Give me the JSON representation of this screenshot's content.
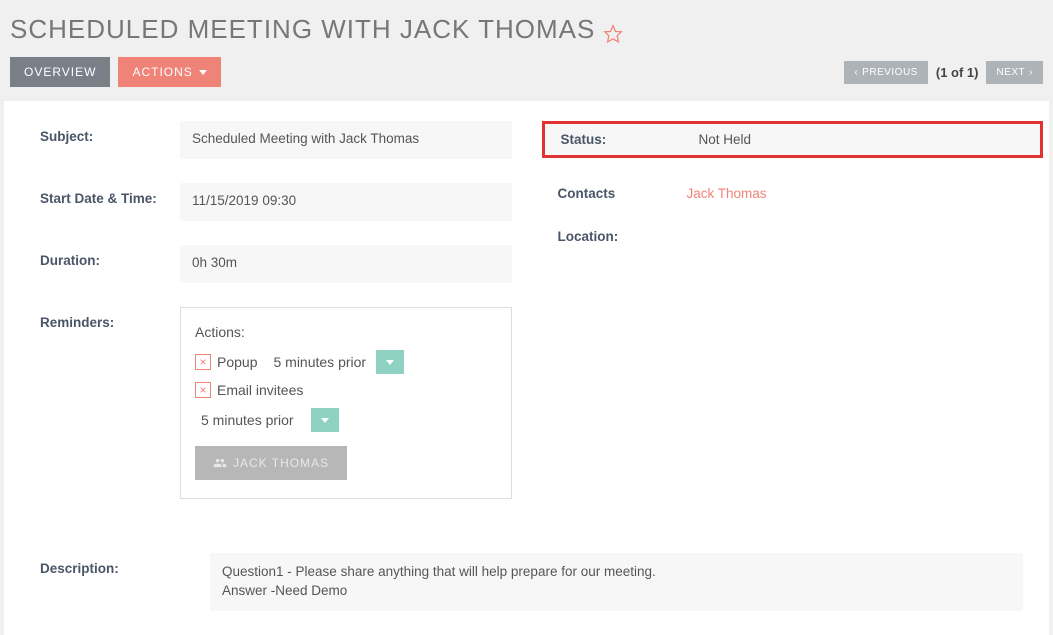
{
  "header": {
    "title": "SCHEDULED MEETING WITH JACK THOMAS"
  },
  "tabs": {
    "overview": "OVERVIEW",
    "actions": "ACTIONS"
  },
  "pager": {
    "previous": "PREVIOUS",
    "count": "(1 of 1)",
    "next": "NEXT"
  },
  "fields": {
    "subject": {
      "label": "Subject:",
      "value": "Scheduled Meeting with Jack Thomas"
    },
    "start": {
      "label": "Start Date & Time:",
      "value": "11/15/2019 09:30"
    },
    "duration": {
      "label": "Duration:",
      "value": "0h 30m"
    },
    "reminders": {
      "label": "Reminders:"
    }
  },
  "reminders": {
    "heading": "Actions:",
    "popup_label": "Popup",
    "popup_value": "5 minutes prior",
    "email_label": "Email invitees",
    "email_value": "5 minutes prior",
    "invitee_name": "JACK THOMAS"
  },
  "right": {
    "status": {
      "label": "Status:",
      "value": "Not Held"
    },
    "contacts": {
      "label": "Contacts",
      "value": "Jack Thomas"
    },
    "location": {
      "label": "Location:",
      "value": ""
    }
  },
  "description": {
    "label": "Description:",
    "value": "Question1 - Please share anything that will help prepare for our meeting.\nAnswer -Need Demo"
  }
}
